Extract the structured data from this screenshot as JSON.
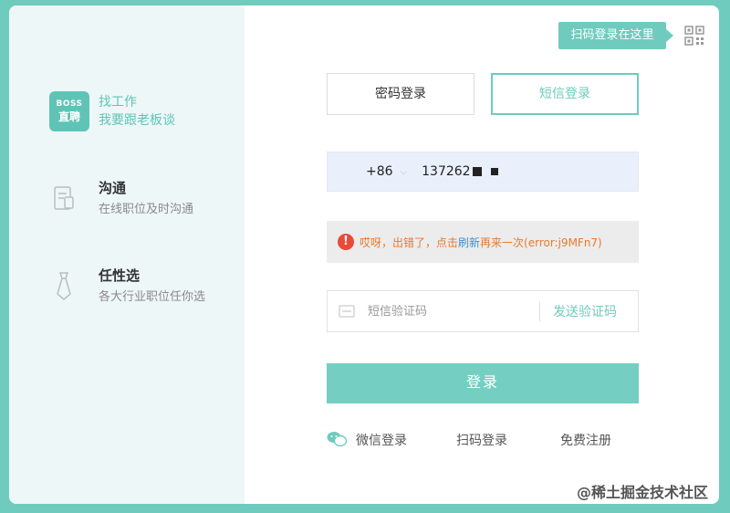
{
  "brand": {
    "logo_top": "BOSS",
    "logo_bottom": "直聘",
    "title": "找工作",
    "subtitle": "我要跟老板谈"
  },
  "features": [
    {
      "title": "沟通",
      "subtitle": "在线职位及时沟通",
      "icon": "document-icon"
    },
    {
      "title": "任性选",
      "subtitle": "各大行业职位任你选",
      "icon": "tie-icon"
    }
  ],
  "qr": {
    "tip": "扫码登录在这里",
    "icon": "qr-code-icon"
  },
  "tabs": [
    {
      "label": "密码登录",
      "active": false
    },
    {
      "label": "短信登录",
      "active": true
    }
  ],
  "phone": {
    "country_code": "+86",
    "number": "137262"
  },
  "error": {
    "prefix": "哎呀，出错了，点击",
    "link": "刷新",
    "suffix": "再来一次(error:j9MFn7)"
  },
  "sms": {
    "placeholder": "短信验证码",
    "send_label": "发送验证码"
  },
  "login_label": "登录",
  "bottom_links": {
    "wechat": "微信登录",
    "scan": "扫码登录",
    "register": "免费注册"
  },
  "watermark": "@稀土掘金技术社区",
  "colors": {
    "accent": "#6fcbbd",
    "error": "#e84b38",
    "error_text": "#e8792d",
    "link": "#3f8fd8"
  }
}
